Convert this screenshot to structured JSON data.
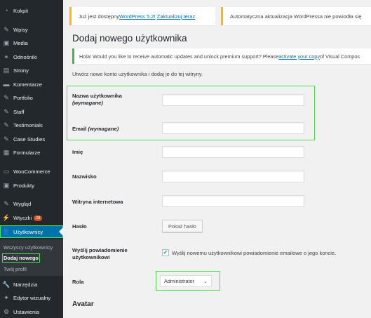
{
  "sidebar": {
    "items": [
      {
        "label": "Kokpit",
        "icon": "dashboard-icon"
      },
      {
        "label": "Wpisy",
        "icon": "pin-icon"
      },
      {
        "label": "Media",
        "icon": "media-icon"
      },
      {
        "label": "Odnośniki",
        "icon": "link-icon"
      },
      {
        "label": "Strony",
        "icon": "page-icon"
      },
      {
        "label": "Komentarze",
        "icon": "comment-icon"
      },
      {
        "label": "Portfolio",
        "icon": "portfolio-icon"
      },
      {
        "label": "Staff",
        "icon": "staff-icon"
      },
      {
        "label": "Testimonials",
        "icon": "testimonials-icon"
      },
      {
        "label": "Case Studies",
        "icon": "case-studies-icon"
      },
      {
        "label": "Formularze",
        "icon": "forms-icon"
      },
      {
        "label": "WooCommerce",
        "icon": "woocommerce-icon"
      },
      {
        "label": "Produkty",
        "icon": "products-icon"
      },
      {
        "label": "Wygląd",
        "icon": "appearance-icon"
      },
      {
        "label": "Wtyczki",
        "icon": "plugins-icon",
        "badge": "28"
      },
      {
        "label": "Użytkownicy",
        "icon": "users-icon"
      },
      {
        "label": "Narzędzia",
        "icon": "tools-icon"
      },
      {
        "label": "Edytor wizualny",
        "icon": "visual-editor-icon"
      },
      {
        "label": "Ustawienia",
        "icon": "settings-icon"
      }
    ],
    "submenu": [
      "Wszyscy użytkownicy",
      "Dodaj nowego",
      "Twój profil"
    ]
  },
  "notices": {
    "update_prefix": "Już jest dostępny ",
    "update_link1": "WordPress 5.2!",
    "update_link2": "Zaktualizuj teraz",
    "update_suffix": ".",
    "auto_update": "Automatyczna aktualizacja WordPressa nie powiodła się",
    "promo_prefix": "Hola! Would you like to receive automatic updates and unlock premium support? Please ",
    "promo_link": "activate your copy",
    "promo_suffix": " of Visual Compos"
  },
  "page": {
    "title": "Dodaj nowego użytkownika",
    "intro": "Utwórz nowe konto użytkownika i dodaj je do tej witryny."
  },
  "form": {
    "username_label": "Nazwa użytkownika",
    "required": "(wymagane)",
    "email_label": "Email",
    "firstname_label": "Imię",
    "lastname_label": "Nazwisko",
    "website_label": "Witryna internetowa",
    "password_label": "Hasło",
    "show_password": "Pokaż hasło",
    "notify_label": "Wyślij powiadomienie użytkownikowi",
    "notify_text": "Wyślij nowemu użytkownikowi powiadomienie emailowe o jego koncie.",
    "notify_checked": true,
    "role_label": "Rola",
    "role_value": "Administrator",
    "avatar_heading": "Avatar"
  },
  "colors": {
    "sidebar_bg": "#23282d",
    "active_blue": "#0073aa",
    "highlight_green": "#4ddf4d",
    "warning_yellow": "#ffb900"
  }
}
